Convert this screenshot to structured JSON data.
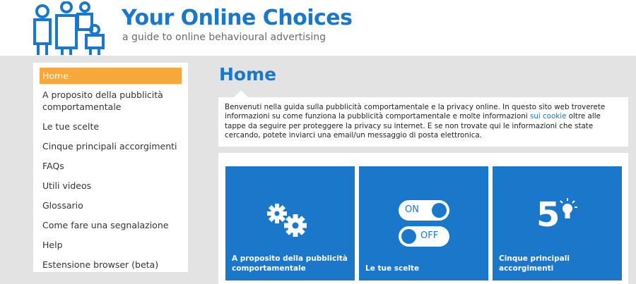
{
  "header": {
    "title": "Your Online Choices",
    "subtitle": "a guide to online behavioural advertising"
  },
  "sidebar": {
    "items": [
      {
        "label": "Home",
        "active": true
      },
      {
        "label": "A proposito della pubblicità comportamentale"
      },
      {
        "label": "Le tue scelte"
      },
      {
        "label": "Cinque principali accorgimenti"
      },
      {
        "label": "FAQs"
      },
      {
        "label": "Utili videos"
      },
      {
        "label": "Glossario"
      },
      {
        "label": "Come fare una segnalazione"
      },
      {
        "label": "Help"
      },
      {
        "label": "Estensione browser (beta)"
      }
    ]
  },
  "main": {
    "title": "Home",
    "intro_before": "Benvenuti nella guida sulla pubblicità comportamentale e la privacy online. In questo sito web troverete informazioni su come funziona la pubblicità comportamentale e molte informazioni ",
    "intro_link": "sui cookie",
    "intro_after": " oltre alle tappe da seguire per proteggere la privacy su internet. E se non trovate qui le informazioni che state cercando, potete inviarci una email/un messaggio di posta elettronica.",
    "tiles": [
      {
        "label": "A proposito della pubblicità comportamentale",
        "icon": "gears-icon"
      },
      {
        "label": "Le tue scelte",
        "icon": "toggle-icon",
        "on_label": "ON",
        "off_label": "OFF"
      },
      {
        "label": "Cinque principali accorgimenti",
        "icon": "five-lightbulb-icon",
        "number": "5"
      }
    ]
  },
  "colors": {
    "brand_blue": "#1a77c9",
    "active_orange": "#f7a83a",
    "background_grey": "#e3e3e3"
  }
}
